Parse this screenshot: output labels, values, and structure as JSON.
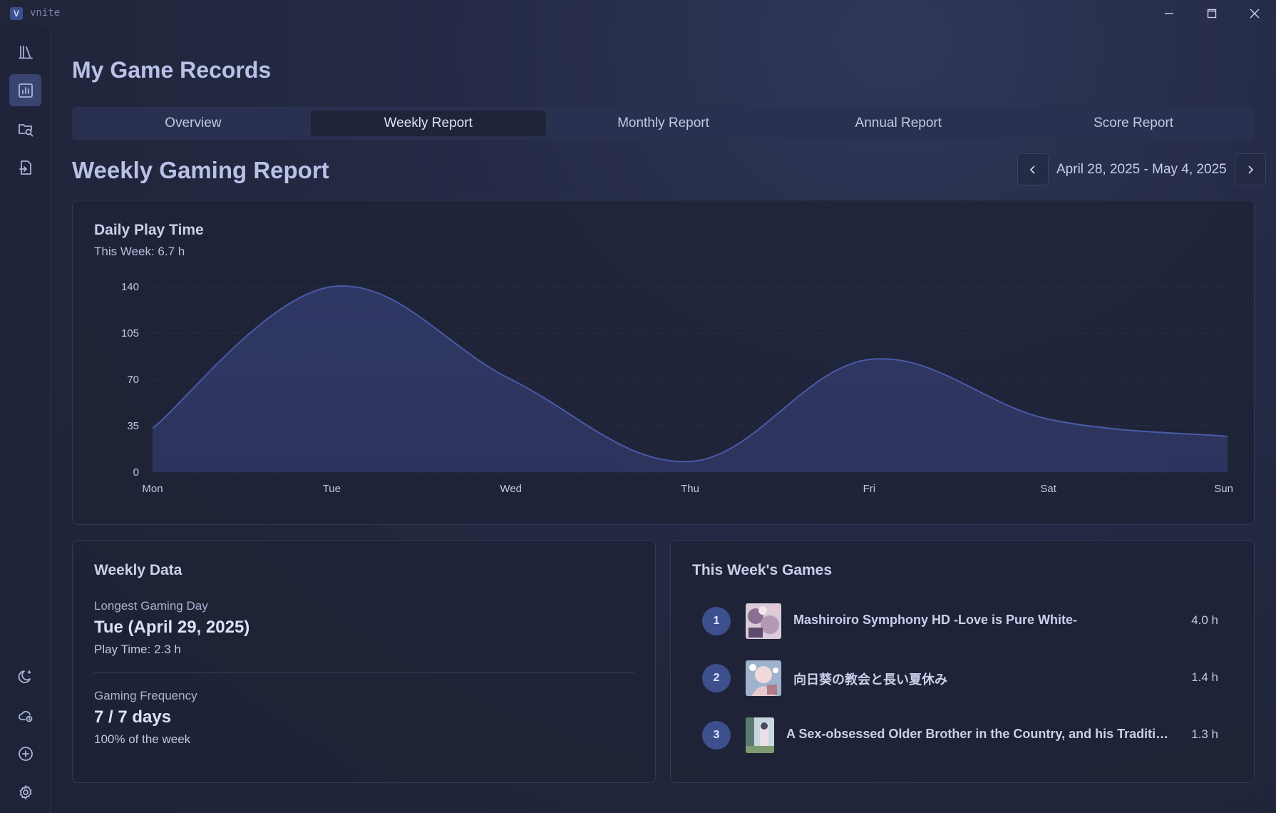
{
  "app": {
    "logo_letter": "V",
    "name": "vnite"
  },
  "page_title": "My Game Records",
  "tabs": [
    {
      "label": "Overview",
      "active": false
    },
    {
      "label": "Weekly Report",
      "active": true
    },
    {
      "label": "Monthly Report",
      "active": false
    },
    {
      "label": "Annual Report",
      "active": false
    },
    {
      "label": "Score Report",
      "active": false
    }
  ],
  "section_title": "Weekly Gaming Report",
  "date_range": "April 28, 2025 - May 4, 2025",
  "daily_card": {
    "title": "Daily Play Time",
    "subtitle": "This Week: 6.7 h"
  },
  "chart_data": {
    "type": "area",
    "categories": [
      "Mon",
      "Tue",
      "Wed",
      "Thu",
      "Fri",
      "Sat",
      "Sun"
    ],
    "series": [
      {
        "values": [
          33,
          140,
          70,
          8,
          85,
          40,
          27
        ]
      }
    ],
    "y_ticks": [
      0,
      35,
      70,
      105,
      140
    ],
    "ylim": [
      0,
      140
    ],
    "grid": true,
    "colors": {
      "line": "#4a5aa8",
      "fill": "#2f3764"
    }
  },
  "weekly_data": {
    "title": "Weekly Data",
    "longest_label": "Longest Gaming Day",
    "longest_value": "Tue (April 29, 2025)",
    "longest_sub": "Play Time: 2.3 h",
    "frequency_label": "Gaming Frequency",
    "frequency_value": "7 / 7 days",
    "frequency_sub": "100% of the week"
  },
  "games": {
    "title": "This Week's Games",
    "items": [
      {
        "rank": "1",
        "name": "Mashiroiro Symphony HD -Love is Pure White-",
        "time": "4.0 h"
      },
      {
        "rank": "2",
        "name": "向日葵の教会と長い夏休み",
        "time": "1.4 h"
      },
      {
        "rank": "3",
        "name": "A Sex-obsessed Older Brother in the Country, and his Traditional Younger Sister",
        "time": "1.3 h"
      }
    ]
  },
  "icons": {
    "sidebar_top": [
      "library-icon",
      "chart-icon",
      "folder-search-icon",
      "file-import-icon"
    ],
    "sidebar_bottom": [
      "moon-icon",
      "cloud-sync-icon",
      "plus-circle-icon",
      "gear-icon"
    ]
  }
}
